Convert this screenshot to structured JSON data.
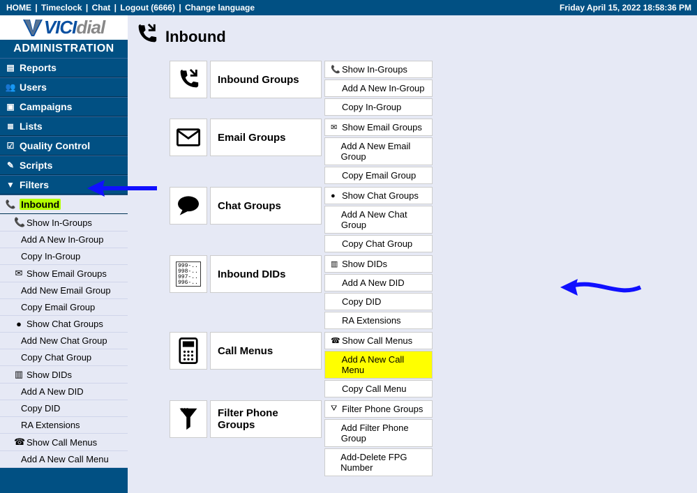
{
  "topbar": {
    "links": [
      "HOME",
      "Timeclock",
      "Chat",
      "Logout (6666)",
      "Change language"
    ],
    "datetime": "Friday April 15, 2022 18:58:36 PM"
  },
  "sidebar": {
    "admin_title": "ADMINISTRATION",
    "items": [
      {
        "icon": "report",
        "label": "Reports"
      },
      {
        "icon": "users",
        "label": "Users"
      },
      {
        "icon": "camp",
        "label": "Campaigns"
      },
      {
        "icon": "list",
        "label": "Lists"
      },
      {
        "icon": "qc",
        "label": "Quality Control"
      },
      {
        "icon": "script",
        "label": "Scripts"
      },
      {
        "icon": "filter",
        "label": "Filters"
      }
    ],
    "selected": {
      "icon": "phone",
      "label": "Inbound"
    },
    "sub": [
      {
        "type": "hdr",
        "icon": "phone",
        "label": "Show In-Groups"
      },
      {
        "type": "sub",
        "label": "Add A New In-Group"
      },
      {
        "type": "sub",
        "label": "Copy In-Group"
      },
      {
        "type": "hdr",
        "icon": "mail",
        "label": "Show Email Groups"
      },
      {
        "type": "sub",
        "label": "Add New Email Group"
      },
      {
        "type": "sub",
        "label": "Copy Email Group"
      },
      {
        "type": "hdr",
        "icon": "chat",
        "label": "Show Chat Groups"
      },
      {
        "type": "sub",
        "label": "Add New Chat Group"
      },
      {
        "type": "sub",
        "label": "Copy Chat Group"
      },
      {
        "type": "hdr",
        "icon": "did",
        "label": "Show DIDs"
      },
      {
        "type": "sub",
        "label": "Add A New DID"
      },
      {
        "type": "sub",
        "label": "Copy DID"
      },
      {
        "type": "sub",
        "label": "RA Extensions"
      },
      {
        "type": "hdr",
        "icon": "menu",
        "label": "Show Call Menus"
      },
      {
        "type": "sub",
        "label": "Add A New Call Menu"
      }
    ]
  },
  "main": {
    "title": "Inbound",
    "sections": [
      {
        "icon": "phone",
        "label": "Inbound Groups",
        "tall": false,
        "links": [
          {
            "icon": "phone",
            "text": "Show In-Groups"
          },
          {
            "icon": "",
            "text": "Add A New In-Group"
          },
          {
            "icon": "",
            "text": "Copy In-Group"
          }
        ]
      },
      {
        "icon": "mail",
        "label": "Email Groups",
        "tall": false,
        "links": [
          {
            "icon": "mail",
            "text": "Show Email Groups"
          },
          {
            "icon": "",
            "text": "Add A New Email Group"
          },
          {
            "icon": "",
            "text": "Copy Email Group"
          }
        ]
      },
      {
        "icon": "chat",
        "label": "Chat Groups",
        "tall": false,
        "links": [
          {
            "icon": "chat",
            "text": "Show Chat Groups"
          },
          {
            "icon": "",
            "text": "Add A New Chat Group"
          },
          {
            "icon": "",
            "text": "Copy Chat Group"
          }
        ]
      },
      {
        "icon": "did",
        "label": "Inbound DIDs",
        "tall": true,
        "links": [
          {
            "icon": "did",
            "text": "Show DIDs"
          },
          {
            "icon": "",
            "text": "Add A New DID"
          },
          {
            "icon": "",
            "text": "Copy DID"
          },
          {
            "icon": "",
            "text": "RA Extensions"
          }
        ]
      },
      {
        "icon": "menu",
        "label": "Call Menus",
        "tall": false,
        "links": [
          {
            "icon": "menu",
            "text": "Show Call Menus"
          },
          {
            "icon": "",
            "text": "Add A New Call Menu",
            "hl": true
          },
          {
            "icon": "",
            "text": "Copy Call Menu"
          }
        ]
      },
      {
        "icon": "fpg",
        "label": "Filter Phone Groups",
        "tall": false,
        "links": [
          {
            "icon": "fpg",
            "text": "Filter Phone Groups"
          },
          {
            "icon": "",
            "text": "Add Filter Phone Group"
          },
          {
            "icon": "",
            "text": "Add-Delete FPG Number"
          }
        ]
      }
    ]
  },
  "did_lines": "999-..\n998-..\n997-..\n996-.."
}
